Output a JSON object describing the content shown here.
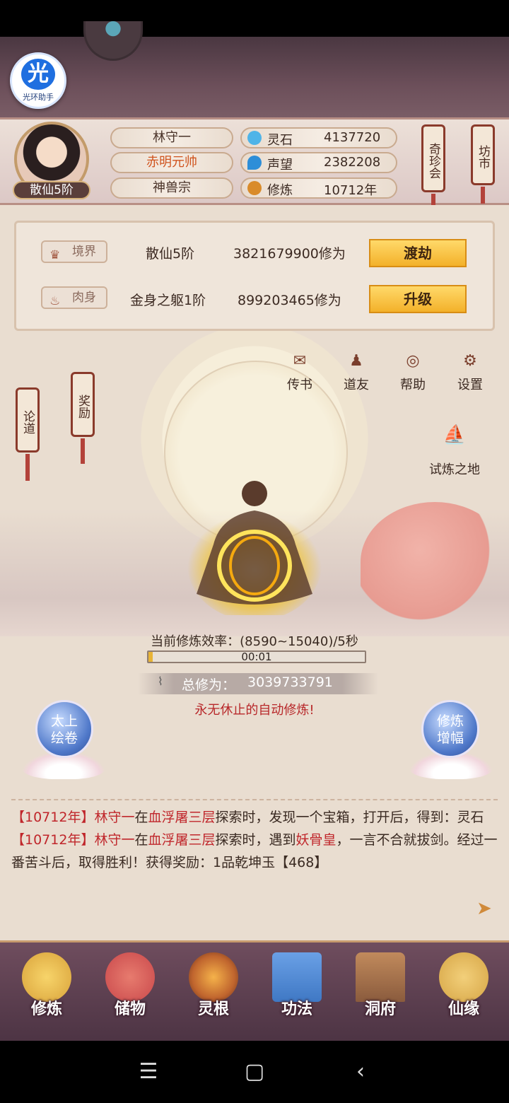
{
  "helper": {
    "big": "光",
    "label": "光环助手"
  },
  "player": {
    "name": "林守一",
    "title": "赤明元帅",
    "sect": "神兽宗",
    "rank": "散仙5阶"
  },
  "stats": [
    {
      "label": "灵石",
      "value": "4137720",
      "icon": "spirit-stone-icon",
      "color": "#4fb4e8"
    },
    {
      "label": "声望",
      "value": "2382208",
      "icon": "reputation-icon",
      "color": "#2d8ed8"
    },
    {
      "label": "修炼",
      "value": "10712年",
      "icon": "meditation-icon",
      "color": "#d98b2a"
    }
  ],
  "side_scrolls": {
    "treasure": "奇珍会",
    "market": "坊市",
    "discuss": "论道",
    "reward": "奖励"
  },
  "realm": {
    "tag_label": "境界",
    "level": "散仙5阶",
    "xp": "3821679900修为",
    "button": "渡劫"
  },
  "body": {
    "tag_label": "肉身",
    "level": "金身之躯1阶",
    "xp": "899203465修为",
    "button": "升级"
  },
  "tools": [
    {
      "label": "传书",
      "glyph": "✉"
    },
    {
      "label": "道友",
      "glyph": "♟"
    },
    {
      "label": "帮助",
      "glyph": "◎"
    },
    {
      "label": "设置",
      "glyph": "⚙"
    }
  ],
  "trial": {
    "label": "试炼之地",
    "glyph": "⛵"
  },
  "cultivation": {
    "efficiency": "当前修炼效率：(8590~15040)/5秒",
    "timer": "00:01",
    "progress": 0.02,
    "total_label": "总修为：",
    "total_value": "3039733791",
    "auto_msg": "永无休止的自动修炼!"
  },
  "orbs": {
    "left": "太上\n绘卷",
    "right": "修炼\n增幅"
  },
  "log": [
    {
      "year": "【10712年】",
      "name": "林守一",
      "pre": "在",
      "place": "血浮屠三层",
      "rest": "探索时，发现一个宝箱，打开后，得到：灵石"
    },
    {
      "year": "【10712年】",
      "name": "林守一",
      "pre": "在",
      "place": "血浮屠三层",
      "mid": "探索时，遇到",
      "enemy": "妖骨皇",
      "rest": "，一言不合就拔剑。经过一番苦斗后，取得胜利！获得奖励：1品乾坤玉【468】"
    }
  ],
  "nav": [
    {
      "label": "修炼",
      "color": "#d9a23a"
    },
    {
      "label": "储物",
      "color": "#c9484b"
    },
    {
      "label": "灵根",
      "color": "#c0652e"
    },
    {
      "label": "功法",
      "color": "#3f78c4"
    },
    {
      "label": "洞府",
      "color": "#8a5b3d"
    },
    {
      "label": "仙缘",
      "color": "#d6a545"
    }
  ]
}
